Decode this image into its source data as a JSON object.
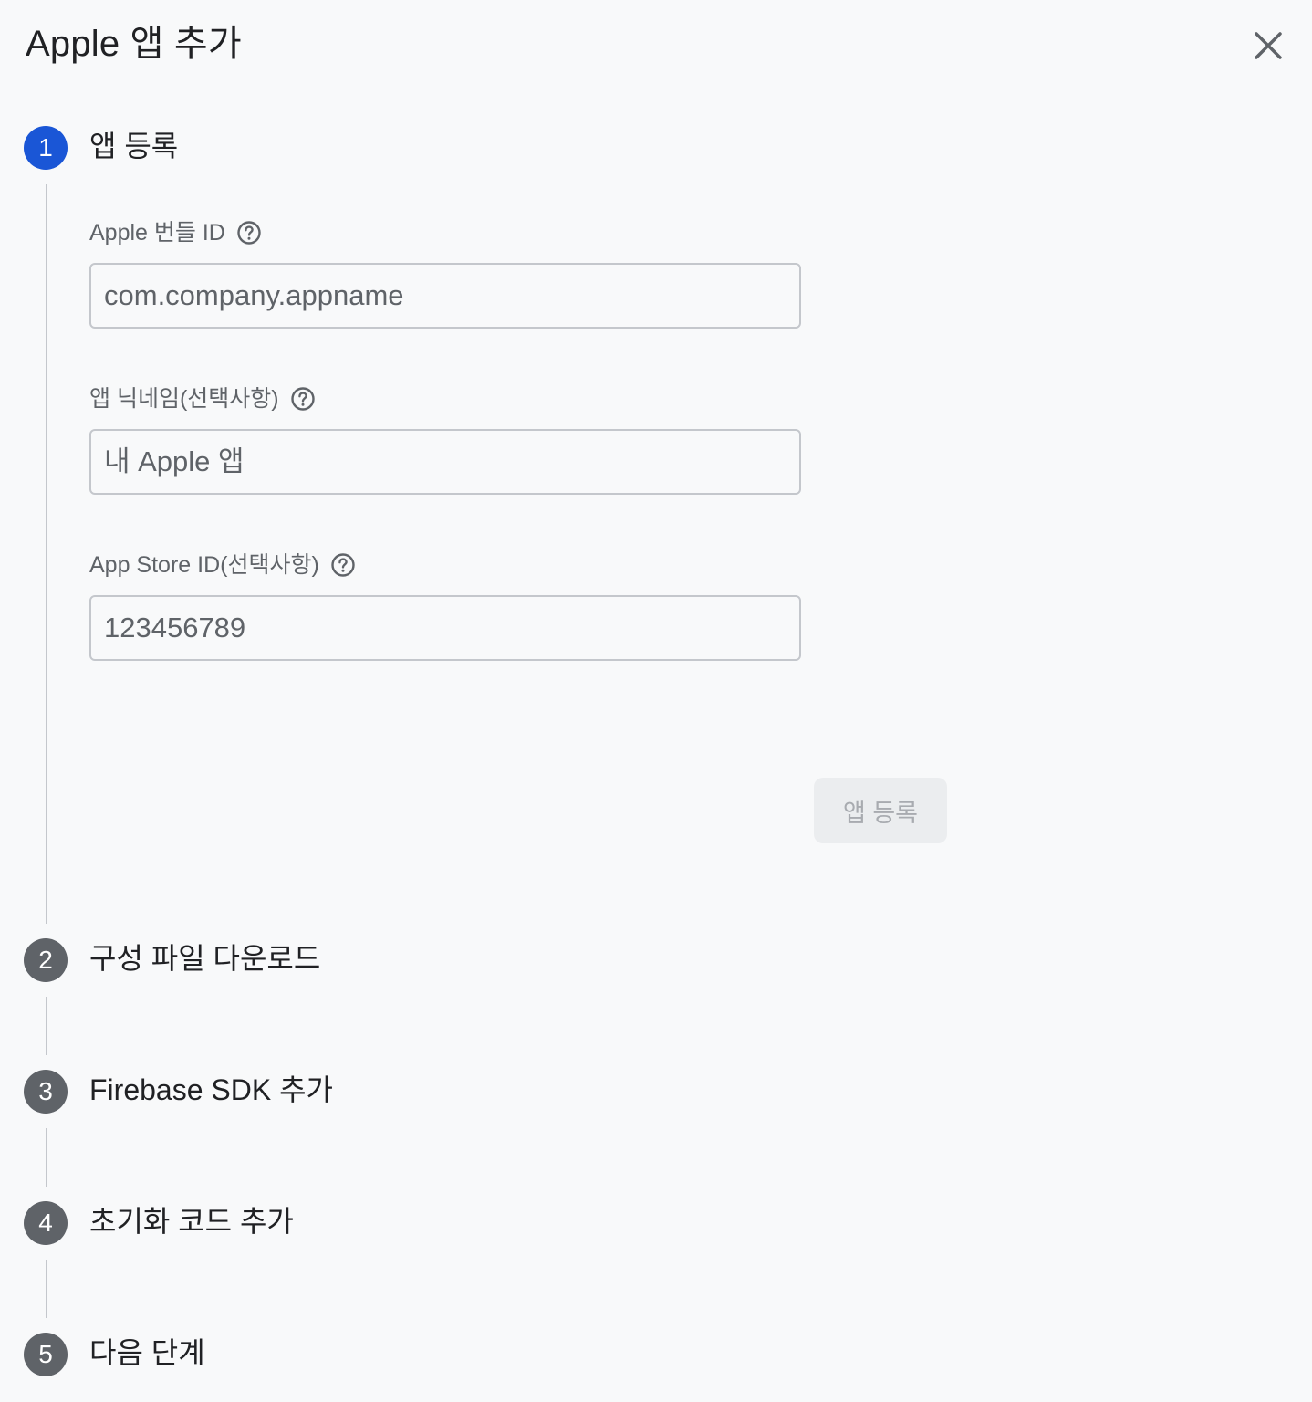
{
  "dialog": {
    "title": "Apple 앱 추가",
    "close_icon": "close-icon"
  },
  "steps": [
    {
      "number": "1",
      "label": "앱 등록",
      "active": true
    },
    {
      "number": "2",
      "label": "구성 파일 다운로드",
      "active": false
    },
    {
      "number": "3",
      "label": "Firebase SDK 추가",
      "active": false
    },
    {
      "number": "4",
      "label": "초기화 코드 추가",
      "active": false
    },
    {
      "number": "5",
      "label": "다음 단계",
      "active": false
    }
  ],
  "form": {
    "bundle_id": {
      "label": "Apple 번들 ID",
      "placeholder": "com.company.appname",
      "value": "",
      "help_icon": "help-circle-icon"
    },
    "nickname": {
      "label": "앱 닉네임(선택사항)",
      "placeholder": "내 Apple 앱",
      "value": "",
      "help_icon": "help-circle-icon"
    },
    "app_store_id": {
      "label": "App Store ID(선택사항)",
      "placeholder": "123456789",
      "value": "",
      "help_icon": "help-circle-icon"
    },
    "register_button": {
      "label": "앱 등록",
      "enabled": false
    }
  },
  "colors": {
    "background": "#f8f9fa",
    "active_step": "#1a56d6",
    "inactive_step": "#5f6368",
    "text_primary": "#202124",
    "text_secondary": "#5f6368",
    "border": "#c4c7cc",
    "button_disabled_bg": "#ebedef",
    "button_disabled_text": "#a8abb0"
  }
}
